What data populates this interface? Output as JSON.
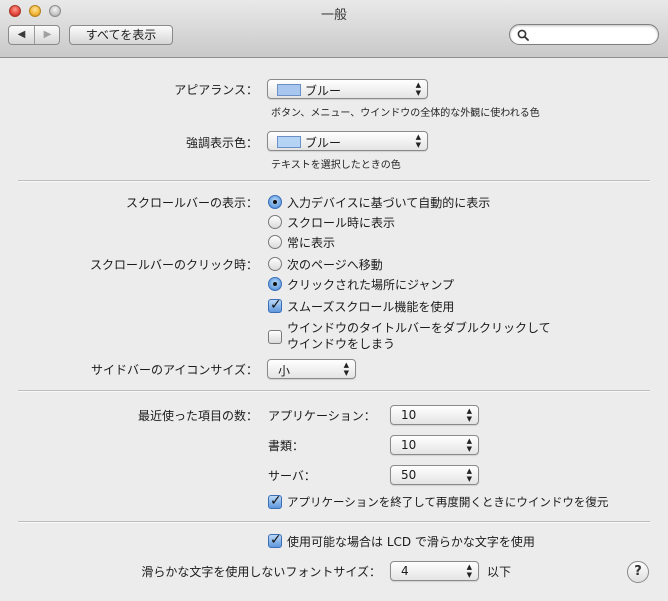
{
  "window": {
    "title": "一般"
  },
  "toolbar": {
    "back_glyph": "◀",
    "forward_glyph": "▶",
    "show_all_label": "すべてを表示"
  },
  "search": {
    "placeholder": "",
    "value": "",
    "icon": "search-icon"
  },
  "appearance": {
    "label": "アピアランス：",
    "value": "ブルー",
    "swatch_color": "#a9c6ee",
    "description": "ボタン、メニュー、ウインドウの全体的な外観に使われる色"
  },
  "highlight": {
    "label": "強調表示色：",
    "value": "ブルー",
    "swatch_color": "#b5d3f5",
    "description": "テキストを選択したときの色"
  },
  "scrollbars": {
    "label": "スクロールバーの表示：",
    "options": [
      "入力デバイスに基づいて自動的に表示",
      "スクロール時に表示",
      "常に表示"
    ],
    "selected_index": 0
  },
  "scroll_click": {
    "label": "スクロールバーのクリック時：",
    "options": [
      "次のページへ移動",
      "クリックされた場所にジャンプ"
    ],
    "selected_index": 1
  },
  "smooth_scroll": {
    "label": "スムーズスクロール機能を使用",
    "checked": true
  },
  "double_click": {
    "line1": "ウインドウのタイトルバーをダブルクリックして",
    "line2": "ウインドウをしまう",
    "checked": false
  },
  "sidebar_icon": {
    "label": "サイドバーのアイコンサイズ：",
    "value": "小"
  },
  "recent": {
    "label": "最近使った項目の数：",
    "applications": {
      "label": "アプリケーション：",
      "value": "10"
    },
    "documents": {
      "label": "書類：",
      "value": "10"
    },
    "servers": {
      "label": "サーバ：",
      "value": "50"
    }
  },
  "restore_windows": {
    "label": "アプリケーションを終了して再度開くときにウインドウを復元",
    "checked": true
  },
  "lcd_smoothing": {
    "label": "使用可能な場合は LCD で滑らかな文字を使用",
    "checked": true
  },
  "font_smoothing": {
    "label": "滑らかな文字を使用しないフォントサイズ：",
    "value": "4",
    "suffix": "以下"
  },
  "help": {
    "label": "?"
  },
  "colors": {
    "accent": "#5e98dc",
    "window_bg": "#ececec"
  }
}
